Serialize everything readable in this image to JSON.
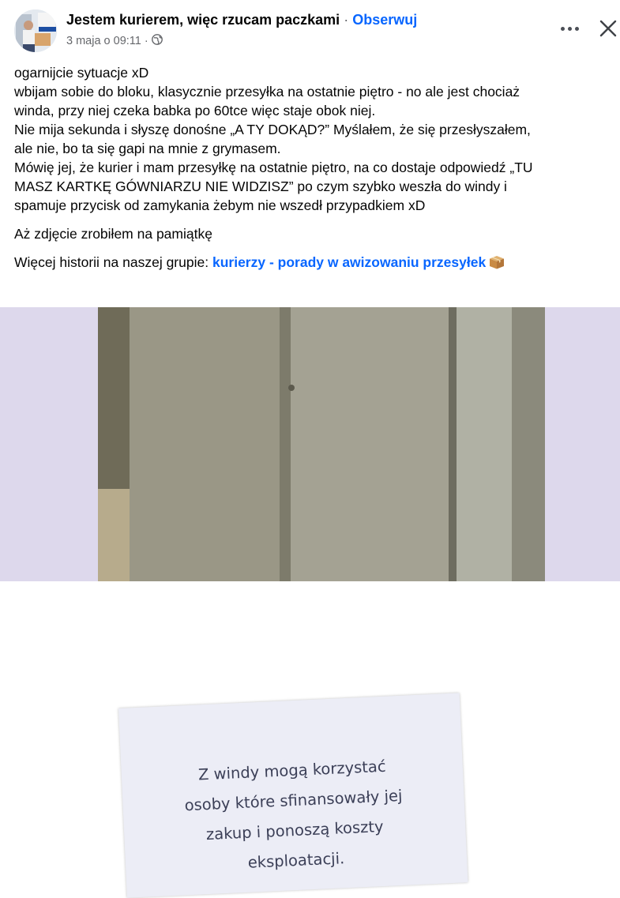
{
  "header": {
    "page_name": "Jestem kurierem, więc rzucam paczkami",
    "separator": "·",
    "follow_label": "Obserwuj",
    "timestamp": "3 maja o 09:11",
    "meta_separator": "·",
    "privacy_icon": "globe-icon",
    "more_icon": "more-options-icon",
    "close_icon": "close-icon"
  },
  "post": {
    "lines": [
      "ogarnijcie sytuacje xD",
      "wbijam sobie do bloku, klasycznie przesyłka na ostatnie piętro - no ale jest chociaż",
      "winda, przy niej czeka babka po 60tce więc staje obok niej.",
      "Nie mija sekunda i słyszę donośne „A TY DOKĄD?” Myślałem, że się przesłyszałem,",
      "ale nie, bo ta się gapi na mnie z grymasem.",
      "Mówię jej, że kurier i mam przesyłkę na ostatnie piętro, na co dostaje odpowiedź „TU",
      "MASZ KARTKĘ GÓWNIARZU NIE WIDZISZ” po czym szybko weszła do windy i",
      "spamuje przycisk od zamykania żebym nie wszedł przypadkiem xD"
    ],
    "photo_caption": "Aż zdjęcie zrobiłem na pamiątkę",
    "more_stories_prefix": "Więcej historii na naszej grupie:",
    "group_link": "kurierzy - porady w awizowaniu przesyłek",
    "package_emoji_icon": "package-icon"
  },
  "photo": {
    "sign_lines": [
      "Z windy mogą korzystać",
      "osoby które sfinansowały jej",
      "zakup i ponoszą koszty",
      "eksploatacji."
    ]
  },
  "colors": {
    "link": "#0866ff",
    "secondary_text": "#65676b",
    "photo_background": "#ddd8ec"
  }
}
